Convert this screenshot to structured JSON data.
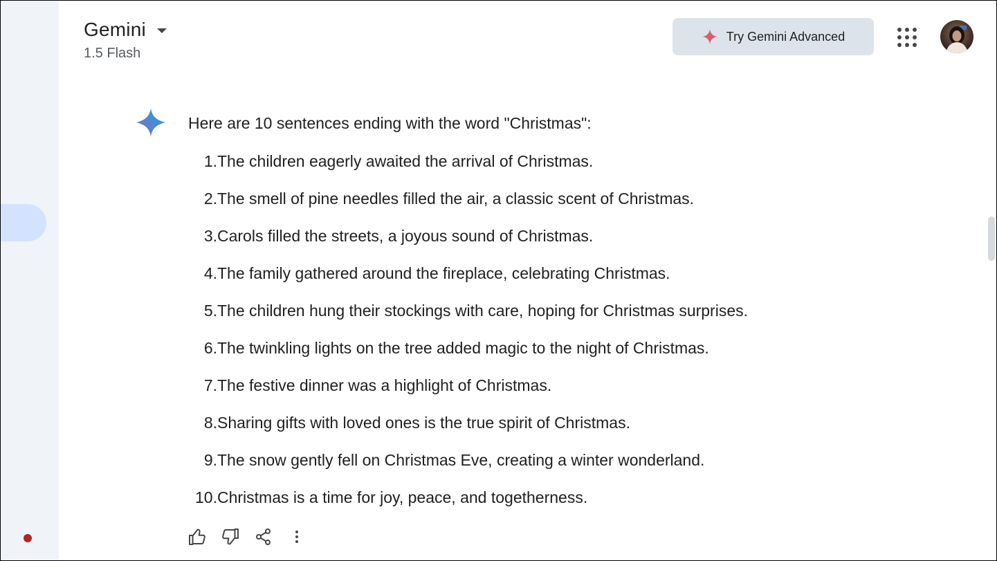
{
  "header": {
    "app_name": "Gemini",
    "model": "1.5 Flash",
    "advanced_button": "Try Gemini Advanced"
  },
  "response": {
    "intro": "Here are 10 sentences ending with the word \"Christmas\":",
    "items": [
      {
        "num": "1.",
        "text": "The children eagerly awaited the arrival of Christmas."
      },
      {
        "num": "2.",
        "text": "The smell of pine needles filled the air, a classic scent of Christmas."
      },
      {
        "num": "3.",
        "text": "Carols filled the streets, a joyous sound of Christmas."
      },
      {
        "num": "4.",
        "text": "The family gathered around the fireplace, celebrating Christmas."
      },
      {
        "num": "5.",
        "text": "The children hung their stockings with care, hoping for Christmas surprises."
      },
      {
        "num": "6.",
        "text": "The twinkling lights on the tree added magic to the night of Christmas."
      },
      {
        "num": "7.",
        "text": "The festive dinner was a highlight of Christmas."
      },
      {
        "num": "8.",
        "text": "Sharing gifts with loved ones is the true spirit of Christmas."
      },
      {
        "num": "9.",
        "text": "The snow gently fell on Christmas Eve, creating a winter wonderland."
      },
      {
        "num": "10.",
        "text": "Christmas is a time for joy, peace, and togetherness."
      }
    ]
  },
  "icons": {
    "caret": "chevron-down-icon",
    "advanced_spark": "sparkle-icon",
    "apps": "apps-grid-icon",
    "avatar": "avatar",
    "logo": "gemini-sparkle-icon",
    "actions": [
      "thumbs-up-icon",
      "thumbs-down-icon",
      "share-icon",
      "more-vertical-icon"
    ]
  },
  "colors": {
    "sidebar_bg": "#f0f4f9",
    "sidebar_active": "#d3e3fd",
    "advanced_btn_bg": "#dde3ea",
    "record_dot": "#b3261e",
    "spark_red": "#d95e6f",
    "text": "#1f1f1f"
  }
}
